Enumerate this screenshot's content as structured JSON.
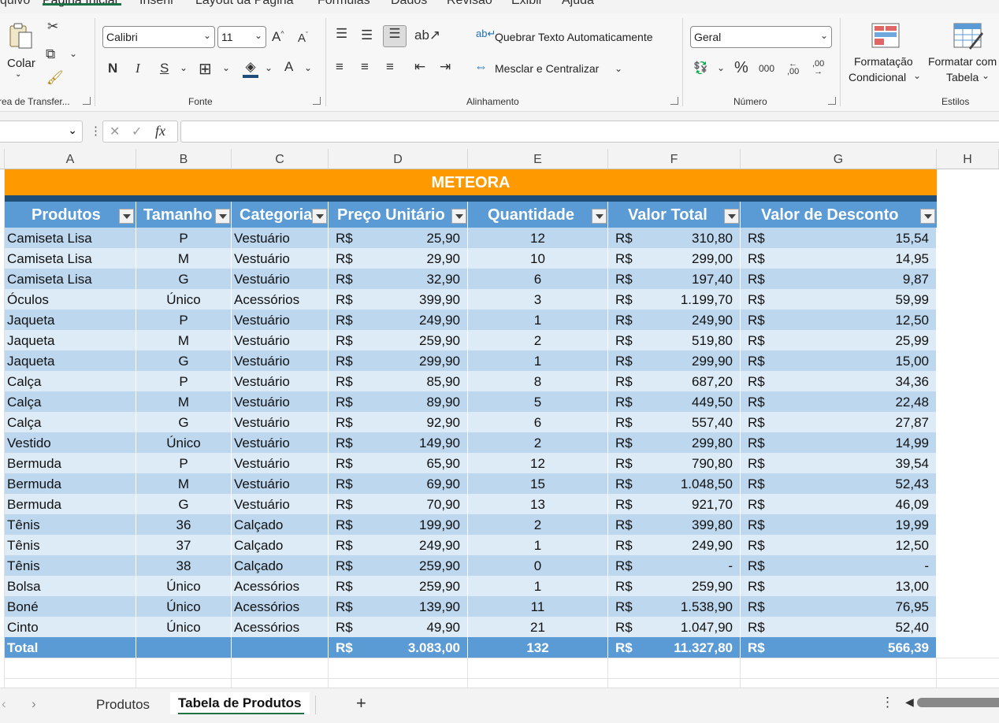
{
  "menu": [
    "quivo",
    "Página Inicial",
    "Inserir",
    "Layout da Página",
    "Fórmulas",
    "Dados",
    "Revisão",
    "Exibir",
    "Ajuda"
  ],
  "ribbon": {
    "paste_label": "Colar",
    "clipboard_label": "rea de Transfer...",
    "font_name": "Calibri",
    "font_size": "11",
    "bold": "N",
    "italic": "I",
    "underline": "S",
    "font_group_label": "Fonte",
    "wrap_text": "Quebrar Texto Automaticamente",
    "merge_center": "Mesclar e Centralizar",
    "alignment_label": "Alinhamento",
    "number_format": "Geral",
    "percent": "%",
    "thousands": "000",
    "inc_decimal": ",00",
    "dec_decimal": ",00",
    "number_label": "Número",
    "cond_format_line1": "Formatação",
    "cond_format_line2": "Condicional",
    "format_table_line1": "Formatar com",
    "format_table_line2": "Tabela",
    "styles_label": "Estilos"
  },
  "formula_bar": {
    "fx": "fx",
    "cancel": "✕",
    "enter": "✓",
    "value": ""
  },
  "columns": [
    "A",
    "B",
    "C",
    "D",
    "E",
    "F",
    "G",
    "H"
  ],
  "table": {
    "title": "METEORA",
    "headers": [
      "Produtos",
      "Tamanho",
      "Categoria",
      "Preço Unitário",
      "Quantidade",
      "Valor Total",
      "Valor de Desconto"
    ],
    "currency": "R$",
    "rows": [
      [
        "Camiseta Lisa",
        "P",
        "Vestuário",
        "25,90",
        "12",
        "310,80",
        "15,54"
      ],
      [
        "Camiseta Lisa",
        "M",
        "Vestuário",
        "29,90",
        "10",
        "299,00",
        "14,95"
      ],
      [
        "Camiseta Lisa",
        "G",
        "Vestuário",
        "32,90",
        "6",
        "197,40",
        "9,87"
      ],
      [
        "Óculos",
        "Único",
        "Acessórios",
        "399,90",
        "3",
        "1.199,70",
        "59,99"
      ],
      [
        "Jaqueta",
        "P",
        "Vestuário",
        "249,90",
        "1",
        "249,90",
        "12,50"
      ],
      [
        "Jaqueta",
        "M",
        "Vestuário",
        "259,90",
        "2",
        "519,80",
        "25,99"
      ],
      [
        "Jaqueta",
        "G",
        "Vestuário",
        "299,90",
        "1",
        "299,90",
        "15,00"
      ],
      [
        "Calça",
        "P",
        "Vestuário",
        "85,90",
        "8",
        "687,20",
        "34,36"
      ],
      [
        "Calça",
        "M",
        "Vestuário",
        "89,90",
        "5",
        "449,50",
        "22,48"
      ],
      [
        "Calça",
        "G",
        "Vestuário",
        "92,90",
        "6",
        "557,40",
        "27,87"
      ],
      [
        "Vestido",
        "Único",
        "Vestuário",
        "149,90",
        "2",
        "299,80",
        "14,99"
      ],
      [
        "Bermuda",
        "P",
        "Vestuário",
        "65,90",
        "12",
        "790,80",
        "39,54"
      ],
      [
        "Bermuda",
        "M",
        "Vestuário",
        "69,90",
        "15",
        "1.048,50",
        "52,43"
      ],
      [
        "Bermuda",
        "G",
        "Vestuário",
        "70,90",
        "13",
        "921,70",
        "46,09"
      ],
      [
        "Tênis",
        "36",
        "Calçado",
        "199,90",
        "2",
        "399,80",
        "19,99"
      ],
      [
        "Tênis",
        "37",
        "Calçado",
        "249,90",
        "1",
        "249,90",
        "12,50"
      ],
      [
        "Tênis",
        "38",
        "Calçado",
        "259,90",
        "0",
        "-",
        "-"
      ],
      [
        "Bolsa",
        "Único",
        "Acessórios",
        "259,90",
        "1",
        "259,90",
        "13,00"
      ],
      [
        "Boné",
        "Único",
        "Acessórios",
        "139,90",
        "11",
        "1.538,90",
        "76,95"
      ],
      [
        "Cinto",
        "Único",
        "Acessórios",
        "49,90",
        "21",
        "1.047,90",
        "52,40"
      ]
    ],
    "total": [
      "Total",
      "",
      "",
      "3.083,00",
      "132",
      "11.327,80",
      "566,39"
    ]
  },
  "sheet_tabs": [
    "Produtos",
    "Tabela de Produtos"
  ],
  "add_sheet": "+",
  "colors": {
    "title_bg": "#ff9900",
    "header_bg": "#5b9bd5",
    "band_dark": "#bdd7ee",
    "band_light": "#ddebf7",
    "navy": "#1f4e79",
    "accent_green": "#1e7145"
  }
}
